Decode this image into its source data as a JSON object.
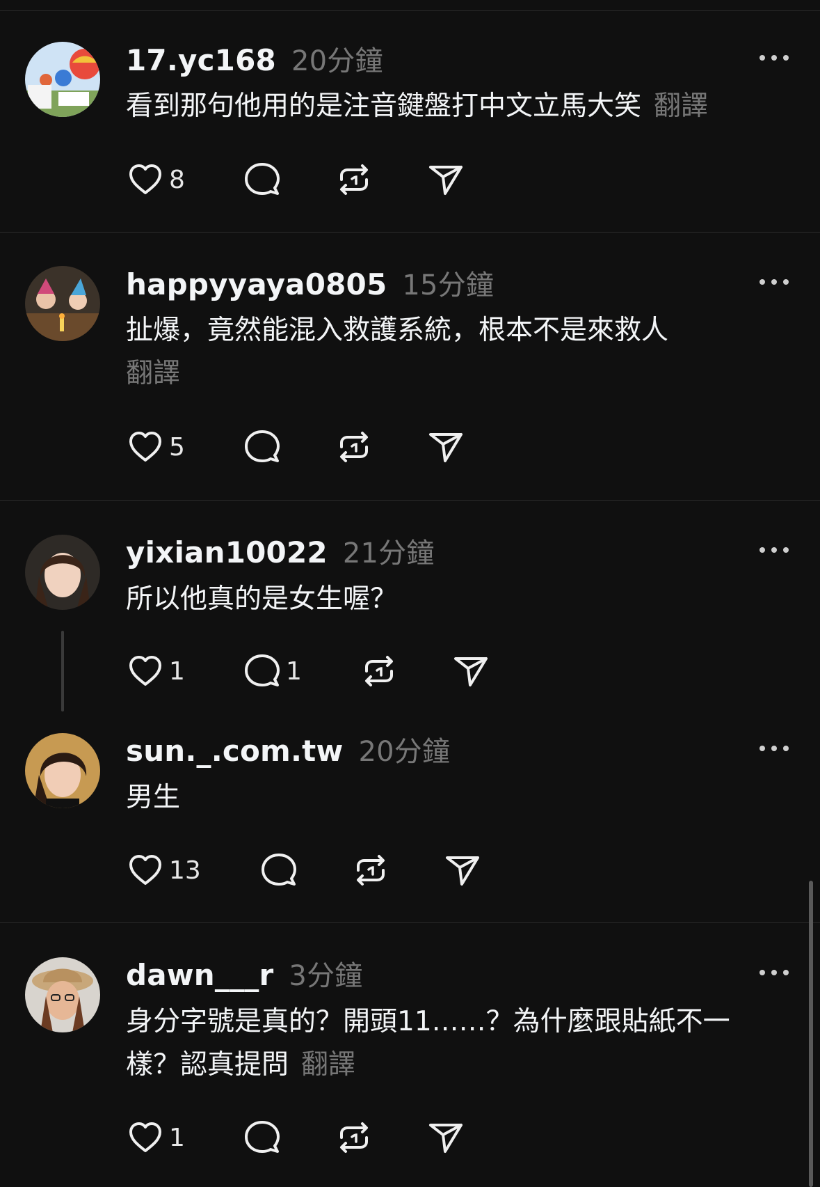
{
  "comments": [
    {
      "username": "17.yc168",
      "time": "20分鐘",
      "text": "看到那句他用的是注音鍵盤打中文立馬大笑",
      "translate": "翻譯",
      "likes": "8",
      "replies": ""
    },
    {
      "username": "happyyaya0805",
      "time": "15分鐘",
      "text": "扯爆，竟然能混入救護系統，根本不是來救人",
      "translate": "翻譯",
      "likes": "5",
      "replies": ""
    },
    {
      "username": "yixian10022",
      "time": "21分鐘",
      "text": "所以他真的是女生喔？",
      "translate": "",
      "likes": "1",
      "replies": "1"
    },
    {
      "username": "sun._.com.tw",
      "time": "20分鐘",
      "text": "男生",
      "translate": "",
      "likes": "13",
      "replies": ""
    },
    {
      "username": "dawn___r",
      "time": "3分鐘",
      "text_line1": "身分字號是真的？開頭11……？為什麼跟貼紙不一",
      "text_line2": "樣？認真提問",
      "translate": "翻譯",
      "likes": "1",
      "replies": ""
    }
  ],
  "icons": [
    "heart-icon",
    "comment-icon",
    "repost-icon",
    "share-icon",
    "more-icon"
  ],
  "colors": {
    "background": "#101010",
    "text": "#f3f5f7",
    "muted": "#777777",
    "divider": "#2b2b2b"
  }
}
